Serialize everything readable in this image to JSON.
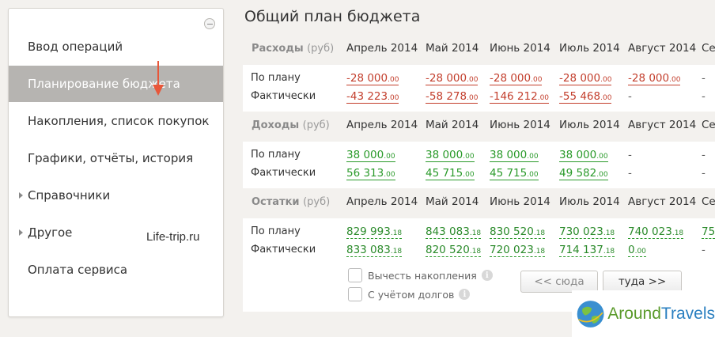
{
  "sidebar": {
    "items": [
      {
        "label": "Ввод операций",
        "expandable": false,
        "active": false
      },
      {
        "label": "Планирование бюджета",
        "expandable": false,
        "active": true
      },
      {
        "label": "Накопления, список покупок",
        "expandable": false,
        "active": false
      },
      {
        "label": "Графики, отчёты, история",
        "expandable": false,
        "active": false
      },
      {
        "label": "Справочники",
        "expandable": true,
        "active": false
      },
      {
        "label": "Другое",
        "expandable": true,
        "active": false
      },
      {
        "label": "Оплата сервиса",
        "expandable": false,
        "active": false
      }
    ],
    "watermark": "Life-trip.ru"
  },
  "main": {
    "title": "Общий план бюджета",
    "months": [
      "Апрель 2014",
      "Май 2014",
      "Июнь 2014",
      "Июль 2014",
      "Август 2014",
      "Се"
    ],
    "sections": [
      {
        "title": "Расходы",
        "unit": "(руб)",
        "rows": [
          {
            "label": "По плану",
            "values": [
              [
                "-28 000",
                ".00"
              ],
              [
                "-28 000",
                ".00"
              ],
              [
                "-28 000",
                ".00"
              ],
              [
                "-28 000",
                ".00"
              ],
              [
                "-28 000",
                ".00"
              ],
              [
                "-",
                ""
              ]
            ]
          },
          {
            "label": "Фактически",
            "values": [
              [
                "-43 223",
                ".00"
              ],
              [
                "-58 278",
                ".00"
              ],
              [
                "-146 212",
                ".00"
              ],
              [
                "-55 468",
                ".00"
              ],
              [
                "-",
                ""
              ],
              [
                "-",
                ""
              ]
            ]
          }
        ]
      },
      {
        "title": "Доходы",
        "unit": "(руб)",
        "rows": [
          {
            "label": "По плану",
            "values": [
              [
                "38 000",
                ".00"
              ],
              [
                "38 000",
                ".00"
              ],
              [
                "38 000",
                ".00"
              ],
              [
                "38 000",
                ".00"
              ],
              [
                "-",
                ""
              ],
              [
                "-",
                ""
              ]
            ]
          },
          {
            "label": "Фактически",
            "values": [
              [
                "56 313",
                ".00"
              ],
              [
                "45 715",
                ".00"
              ],
              [
                "45 715",
                ".00"
              ],
              [
                "49 582",
                ".00"
              ],
              [
                "-",
                ""
              ],
              [
                "-",
                ""
              ]
            ]
          }
        ]
      },
      {
        "title": "Остатки",
        "unit": "(руб)",
        "rows": [
          {
            "label": "По плану",
            "values": [
              [
                "829 993",
                ".18"
              ],
              [
                "843 083",
                ".18"
              ],
              [
                "830 520",
                ".18"
              ],
              [
                "730 023",
                ".18"
              ],
              [
                "740 023",
                ".18"
              ],
              [
                "75",
                ""
              ]
            ]
          },
          {
            "label": "Фактически",
            "values": [
              [
                "833 083",
                ".18"
              ],
              [
                "820 520",
                ".18"
              ],
              [
                "720 023",
                ".18"
              ],
              [
                "714 137",
                ".18"
              ],
              [
                "0",
                ".00"
              ],
              [
                "-",
                ""
              ]
            ]
          }
        ]
      }
    ],
    "options": [
      {
        "label": "Вычесть накопления",
        "checked": false,
        "info_icon": "info-icon"
      },
      {
        "label": "С учётом долгов",
        "checked": false,
        "info_icon": "info-icon"
      }
    ],
    "nav": {
      "prev": "<< сюда",
      "next": "туда >>"
    }
  },
  "watermark_logo": {
    "text_a": "Around",
    "text_b": "Travels"
  },
  "colors": {
    "negative": "#c33e2c",
    "positive": "#2a9a2a",
    "active_menu": "#b6b4b1"
  }
}
